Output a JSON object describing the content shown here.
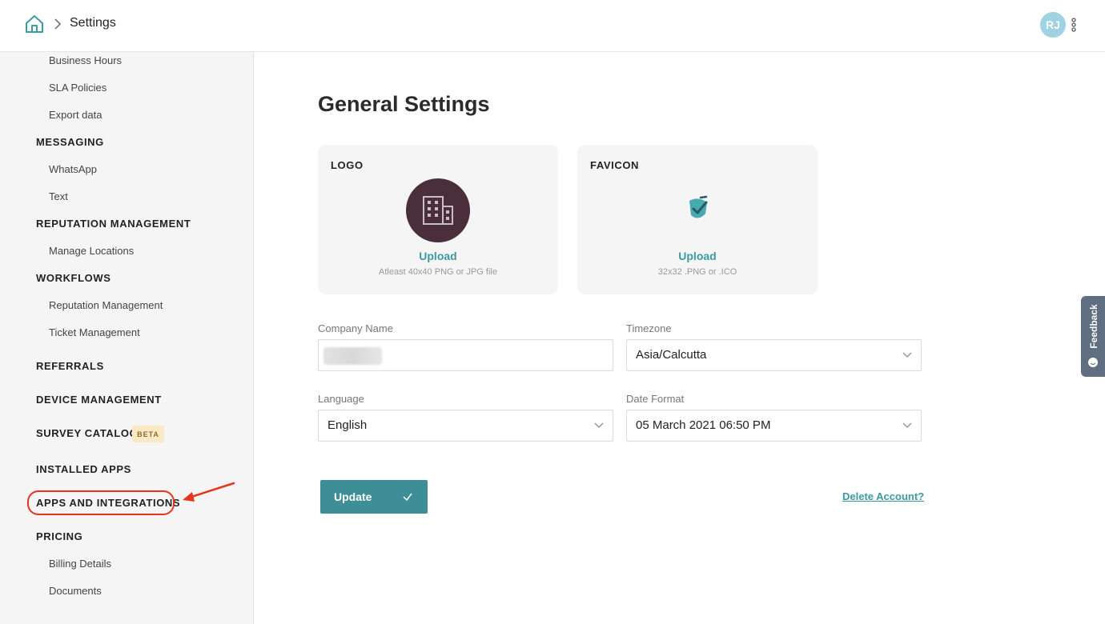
{
  "header": {
    "breadcrumb_current": "Settings",
    "avatar_initials": "RJ"
  },
  "sidebar": {
    "items": [
      {
        "label": "Business Hours",
        "kind": "item"
      },
      {
        "label": "SLA Policies",
        "kind": "item"
      },
      {
        "label": "Export data",
        "kind": "item"
      },
      {
        "label": "MESSAGING",
        "kind": "section"
      },
      {
        "label": "WhatsApp",
        "kind": "item"
      },
      {
        "label": "Text",
        "kind": "item"
      },
      {
        "label": "REPUTATION MANAGEMENT",
        "kind": "section"
      },
      {
        "label": "Manage Locations",
        "kind": "item"
      },
      {
        "label": "WORKFLOWS",
        "kind": "section"
      },
      {
        "label": "Reputation Management",
        "kind": "item"
      },
      {
        "label": "Ticket Management",
        "kind": "item"
      },
      {
        "label": "REFERRALS",
        "kind": "section"
      },
      {
        "label": "DEVICE MANAGEMENT",
        "kind": "section"
      },
      {
        "label": "SURVEY CATALOG",
        "kind": "section"
      },
      {
        "label": "INSTALLED APPS",
        "kind": "section"
      },
      {
        "label": "APPS AND INTEGRATIONS",
        "kind": "section"
      },
      {
        "label": "PRICING",
        "kind": "section"
      },
      {
        "label": "Billing Details",
        "kind": "item"
      },
      {
        "label": "Documents",
        "kind": "item"
      }
    ],
    "beta_badge": "BETA"
  },
  "main": {
    "title": "General Settings",
    "logo_card": {
      "label": "LOGO",
      "upload": "Upload",
      "hint": "Atleast 40x40 PNG or JPG file"
    },
    "favicon_card": {
      "label": "FAVICON",
      "upload": "Upload",
      "hint": "32x32 .PNG or .ICO"
    },
    "fields": {
      "company_name_label": "Company Name",
      "company_name_value": "",
      "timezone_label": "Timezone",
      "timezone_value": "Asia/Calcutta",
      "language_label": "Language",
      "language_value": "English",
      "date_format_label": "Date Format",
      "date_format_value": "05 March 2021 06:50 PM"
    },
    "update_button": "Update",
    "delete_link": "Delete Account?"
  },
  "feedback_tab": "Feedback",
  "colors": {
    "accent": "#3d8e96",
    "link": "#3b9aa3",
    "annotation_red": "#e8341c",
    "logo_bg": "#4a2f3a"
  },
  "icons": {
    "home": "home-icon",
    "breadcrumb_separator": "chevron-right-icon",
    "more": "kebab-menu-icon",
    "logo_placeholder": "building-icon",
    "favicon": "brand-check-icon",
    "select": "chevron-down-icon",
    "update": "check-icon"
  }
}
